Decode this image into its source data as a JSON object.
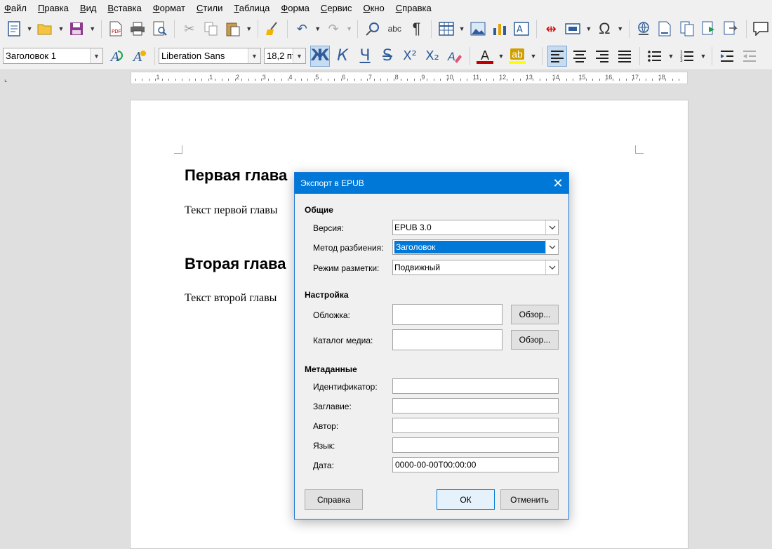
{
  "menu": [
    "Файл",
    "Правка",
    "Вид",
    "Вставка",
    "Формат",
    "Стили",
    "Таблица",
    "Форма",
    "Сервис",
    "Окно",
    "Справка"
  ],
  "toolbar2": {
    "paragraph_style": "Заголовок 1",
    "font_name": "Liberation Sans",
    "font_size": "18,2 пт",
    "bold": "Ж",
    "italic": "К",
    "underline": "Ч",
    "strike": "S",
    "superscript": "X²",
    "subscript": "X₂",
    "font_color_letter": "A",
    "highlight_letter": "ab"
  },
  "ruler_numbers": [
    "1",
    "1",
    "2",
    "3",
    "4",
    "5",
    "6",
    "7",
    "8",
    "9",
    "10",
    "11",
    "12",
    "13",
    "14",
    "15",
    "16",
    "17",
    "18"
  ],
  "document": {
    "heading1": "Первая глава",
    "para1": "Текст первой главы",
    "heading2": "Вторая глава",
    "para2": "Текст второй главы"
  },
  "dialog": {
    "title": "Экспорт в EPUB",
    "general_section": "Общие",
    "version_label": "Версия:",
    "version_value": "EPUB 3.0",
    "split_label": "Метод разбиения:",
    "split_value": "Заголовок",
    "layout_label": "Режим разметки:",
    "layout_value": "Подвижный",
    "settings_section": "Настройка",
    "cover_label": "Обложка:",
    "cover_value": "",
    "media_label": "Каталог медиа:",
    "media_value": "",
    "browse_label": "Обзор...",
    "metadata_section": "Метаданные",
    "id_label": "Идентификатор:",
    "id_value": "",
    "title_label": "Заглавие:",
    "title_value": "",
    "author_label": "Автор:",
    "author_value": "",
    "language_label": "Язык:",
    "language_value": "",
    "date_label": "Дата:",
    "date_value": "0000-00-00T00:00:00",
    "help_button": "Справка",
    "ok_button": "ОК",
    "cancel_button": "Отменить"
  },
  "colors": {
    "accent": "#0078d7",
    "font_color": "#c00000",
    "highlight_color": "#ffff00"
  }
}
